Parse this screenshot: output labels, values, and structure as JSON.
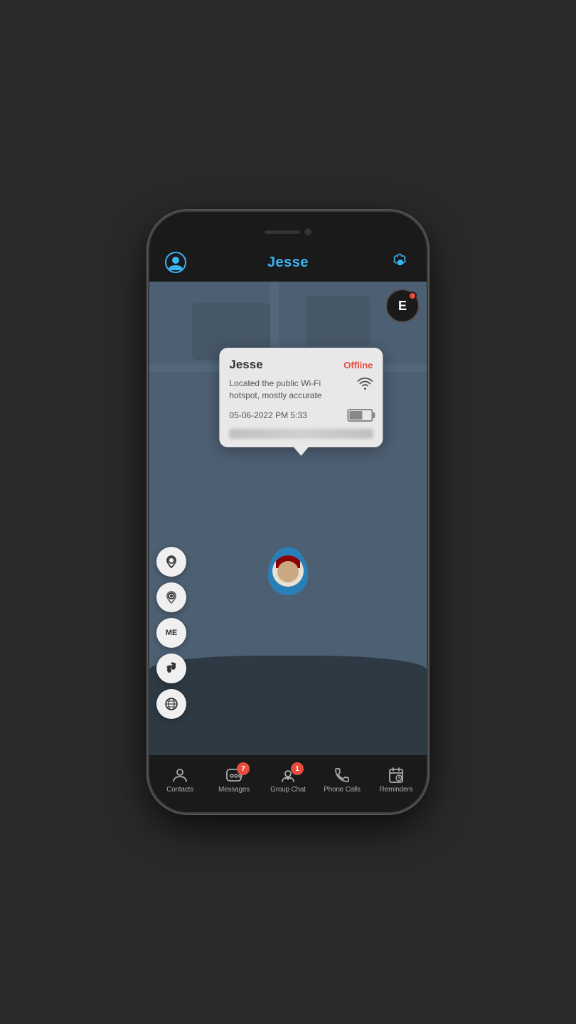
{
  "header": {
    "title": "Jesse",
    "profile_icon": "person-circle-icon",
    "settings_icon": "gear-icon"
  },
  "map": {
    "user_initial": "E",
    "popup": {
      "name": "Jesse",
      "status": "Offline",
      "location_text": "Located the public Wi-Fi hotspot, mostly accurate",
      "datetime": "05-06-2022 PM 5:33",
      "battery_percent": 60
    }
  },
  "sidebar_buttons": [
    {
      "id": "location-pin",
      "label": "location pin"
    },
    {
      "id": "location-search",
      "label": "location search"
    },
    {
      "id": "me-location",
      "label": "me location"
    },
    {
      "id": "footprint",
      "label": "footprint"
    },
    {
      "id": "globe",
      "label": "globe"
    }
  ],
  "bottom_nav": [
    {
      "id": "contacts",
      "label": "Contacts",
      "icon": "contacts-icon",
      "badge": null
    },
    {
      "id": "messages",
      "label": "Messages",
      "icon": "messages-icon",
      "badge": "7"
    },
    {
      "id": "group-chat",
      "label": "Group Chat",
      "icon": "group-chat-icon",
      "badge": "1"
    },
    {
      "id": "phone-calls",
      "label": "Phone Calls",
      "icon": "phone-icon",
      "badge": null
    },
    {
      "id": "reminders",
      "label": "Reminders",
      "icon": "reminders-icon",
      "badge": null
    }
  ]
}
